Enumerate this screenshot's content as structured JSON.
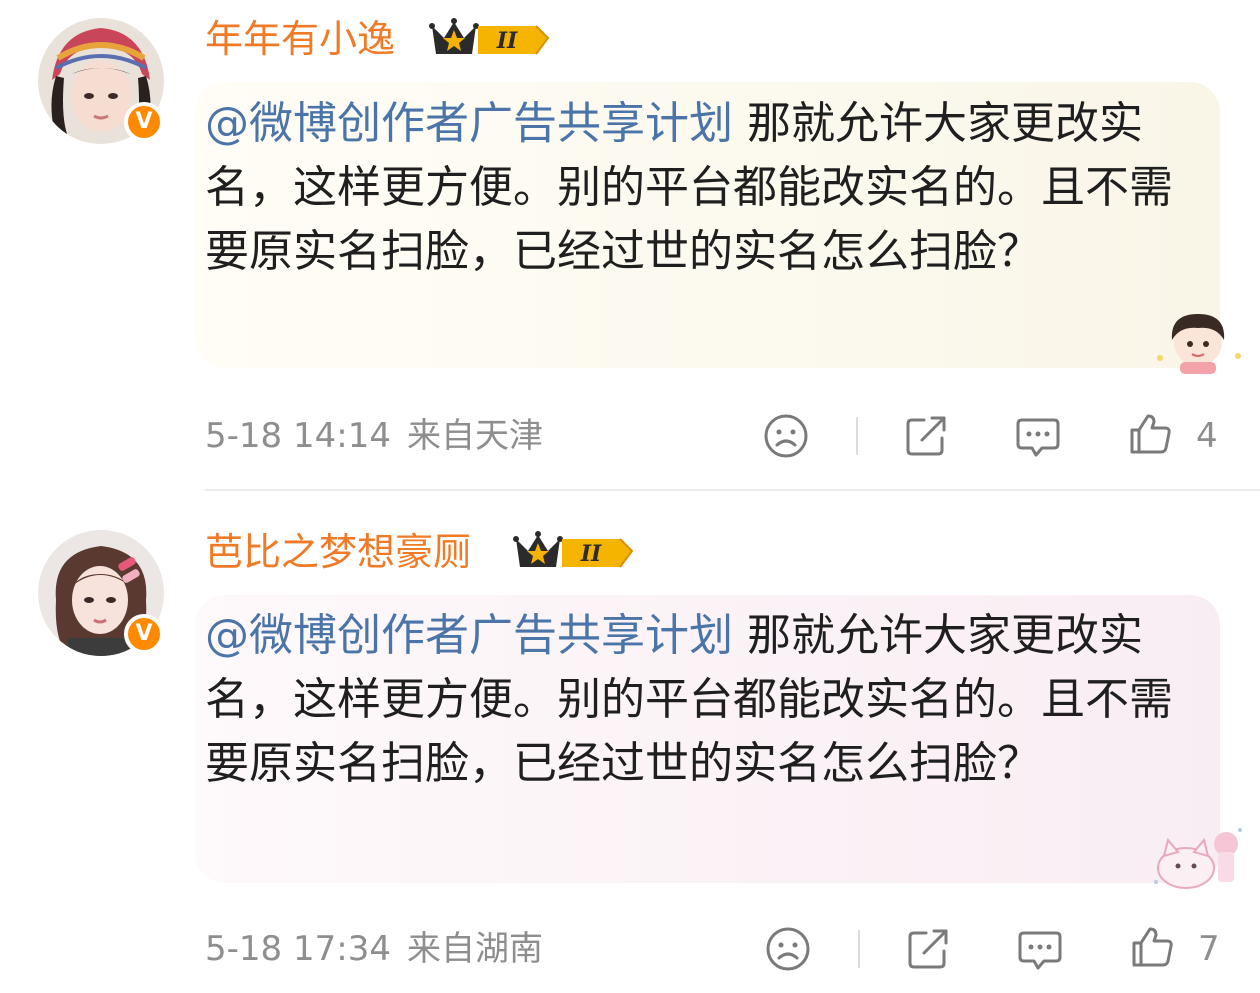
{
  "comments": [
    {
      "username": "年年有小逸",
      "verified_badge": "V",
      "level_badge": "II",
      "mention": "@微博创作者广告共享计划",
      "text": " 那就允许大家更改实名，这样更方便。别的平台都能改实名的。且不需要原实名扫脸，已经过世的实名怎么扫脸？",
      "time": "5-18 14:14",
      "location": "来自天津",
      "likes": "4",
      "bubble_colors": [
        "#fdfbf0",
        "#f8f6e6"
      ],
      "avatar_icon": "girl-avatar-knit-hat"
    },
    {
      "username": "芭比之梦想豪厕",
      "verified_badge": "V",
      "level_badge": "II",
      "mention": "@微博创作者广告共享计划",
      "text": " 那就允许大家更改实名，这样更方便。别的平台都能改实名的。且不需要原实名扫脸，已经过世的实名怎么扫脸？",
      "time": "5-18 17:34",
      "location": "来自湖南",
      "likes": "7",
      "bubble_colors": [
        "#fdf6f8",
        "#f8ecf2"
      ],
      "avatar_icon": "girl-avatar-hair-clip"
    }
  ],
  "colors": {
    "username": "#f07a26",
    "mention": "#4b74a8",
    "text": "#1f1f1f",
    "meta": "#8e8e8e",
    "verified": "#ff8a00"
  },
  "icons": [
    "sad-face-icon",
    "share-icon",
    "comment-icon",
    "thumbs-up-icon"
  ]
}
